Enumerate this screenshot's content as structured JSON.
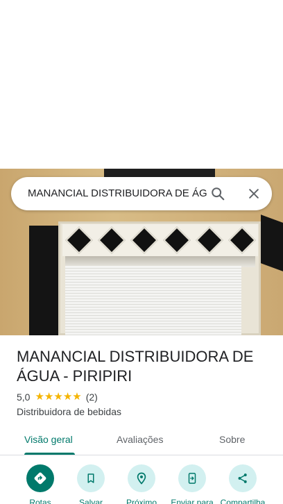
{
  "search": {
    "query": "MANANCIAL DISTRIBUIDORA DE ÁG",
    "search_icon": "search-icon",
    "close_icon": "close-icon"
  },
  "place": {
    "title": "MANANCIAL DISTRIBUIDORA DE ÁGUA - PIRIPIRI",
    "rating": "5,0",
    "stars": 5,
    "reviews_count": "(2)",
    "category": "Distribuidora de bebidas",
    "star_color": "#f5b400"
  },
  "tabs": [
    {
      "label": "Visão geral",
      "active": true
    },
    {
      "label": "Avaliações",
      "active": false
    },
    {
      "label": "Sobre",
      "active": false
    }
  ],
  "actions": [
    {
      "label": "Rotas",
      "icon": "directions-icon"
    },
    {
      "label": "Salvar",
      "icon": "bookmark-icon"
    },
    {
      "label": "Próximo",
      "icon": "nearby-icon"
    },
    {
      "label": "Enviar para",
      "icon": "send-to-phone-icon"
    },
    {
      "label": "Compartilha",
      "icon": "share-icon"
    }
  ],
  "colors": {
    "accent": "#00796b",
    "action_bg": "#d2f0f0"
  }
}
